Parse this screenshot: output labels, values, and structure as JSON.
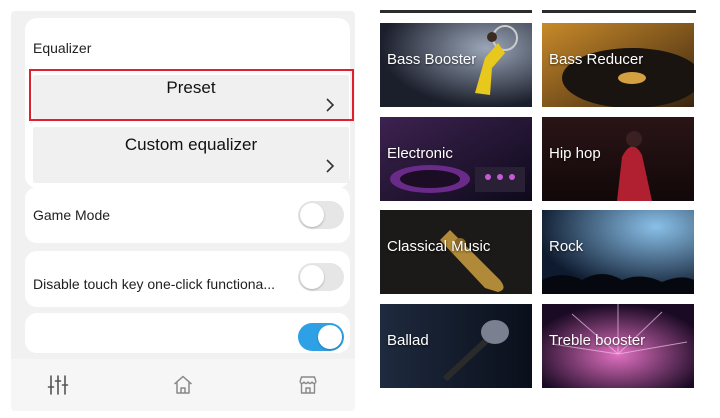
{
  "equalizer": {
    "title": "Equalizer",
    "preset_label": "Preset",
    "custom_label": "Custom equalizer"
  },
  "settings": {
    "game_mode": {
      "label": "Game Mode",
      "enabled": false
    },
    "touch_key": {
      "label": "Disable touch key one-click functiona...",
      "enabled": false
    },
    "partial_row": {
      "label": "",
      "enabled": true
    }
  },
  "bottom_nav": {
    "icons": [
      "equalizer-icon",
      "home-icon",
      "store-icon"
    ]
  },
  "presets": [
    {
      "label": "Bass Booster"
    },
    {
      "label": "Bass Reducer"
    },
    {
      "label": "Electronic"
    },
    {
      "label": "Hip hop"
    },
    {
      "label": "Classical Music"
    },
    {
      "label": "Rock"
    },
    {
      "label": "Ballad"
    },
    {
      "label": "Treble booster"
    }
  ],
  "colors": {
    "highlight": "#e0202a",
    "toggle_on": "#2ea1e6",
    "toggle_off": "#e6e6e6"
  }
}
